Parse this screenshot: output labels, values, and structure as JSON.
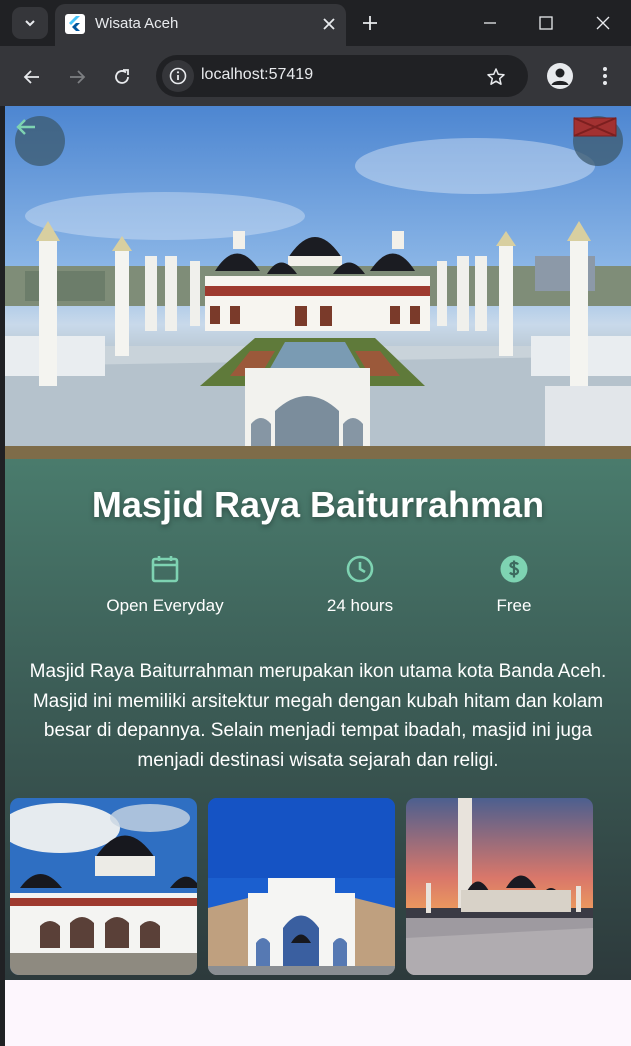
{
  "browser": {
    "tab_title": "Wisata Aceh",
    "url": "localhost:57419"
  },
  "page": {
    "title": "Masjid Raya Baiturrahman",
    "info": [
      {
        "icon": "calendar-icon",
        "label": "Open Everyday"
      },
      {
        "icon": "clock-icon",
        "label": "24 hours"
      },
      {
        "icon": "dollar-icon",
        "label": "Free"
      }
    ],
    "description": "Masjid Raya Baiturrahman merupakan ikon utama kota Banda Aceh. Masjid ini memiliki arsitektur megah dengan kubah hitam dan kolam besar di depannya. Selain menjadi tempat ibadah, masjid ini juga menjadi destinasi wisata sejarah dan religi.",
    "gallery_count": 3
  },
  "colors": {
    "accent": "#7ed3b2",
    "gradient_top": "#5b9a83",
    "gradient_bottom": "#2d3a3c",
    "chrome_dark": "#202124",
    "chrome_toolbar": "#35363a"
  }
}
